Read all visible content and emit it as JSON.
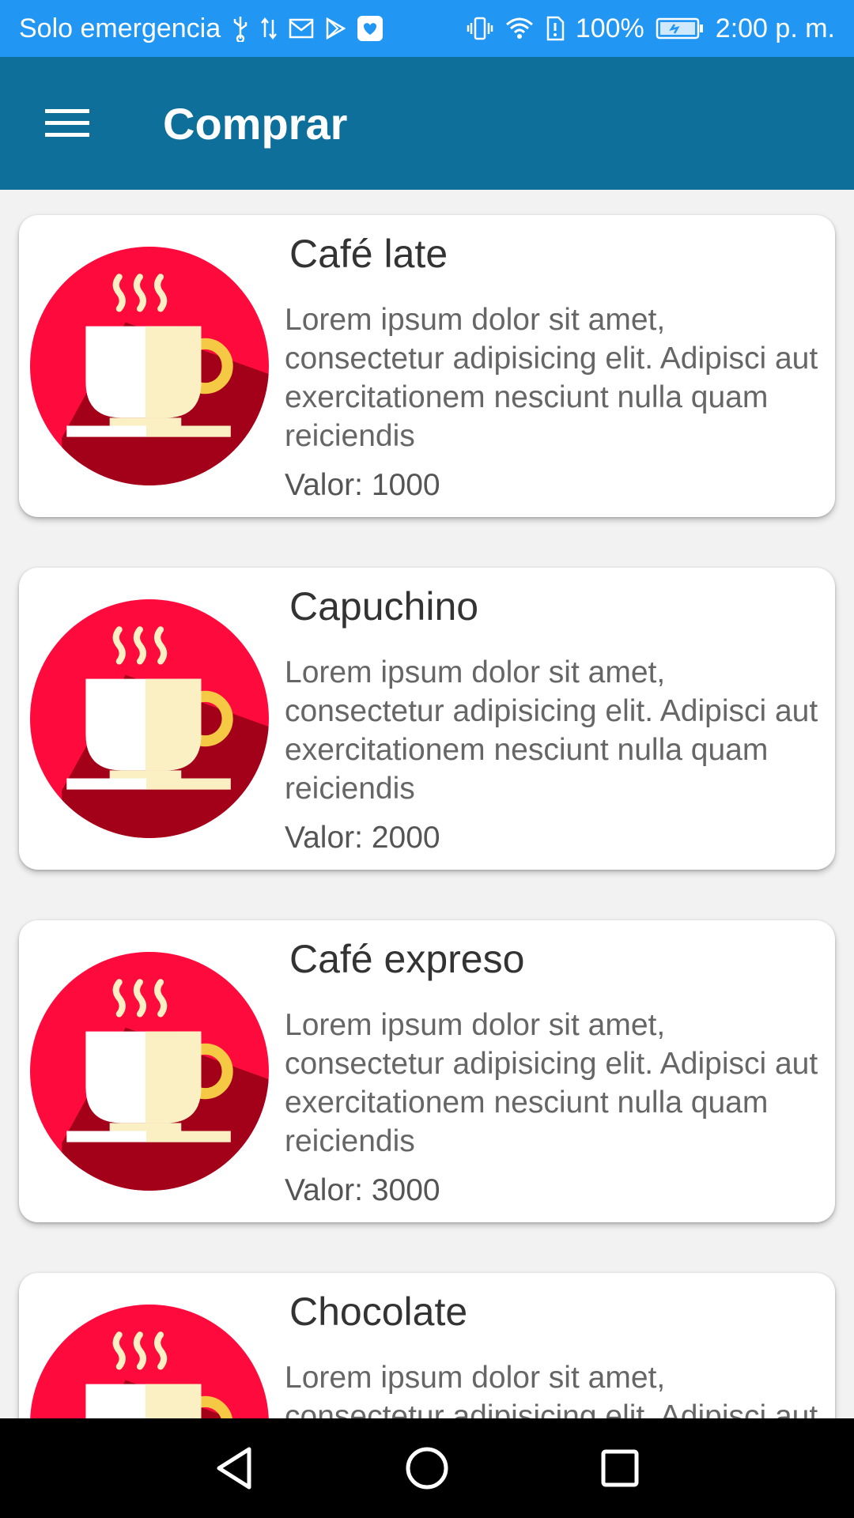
{
  "status_bar": {
    "carrier": "Solo emergencia",
    "battery": "100%",
    "time": "2:00 p. m."
  },
  "app_bar": {
    "title": "Comprar",
    "menu_icon": "hamburger-menu-icon"
  },
  "products": [
    {
      "name": "Café late",
      "description": "Lorem ipsum dolor sit amet, consectetur adipisicing elit. Adipisci aut exercitationem nesciunt nulla quam reiciendis",
      "price": "Valor: 1000",
      "icon": "coffee-cup-icon"
    },
    {
      "name": "Capuchino",
      "description": "Lorem ipsum dolor sit amet, consectetur adipisicing elit. Adipisci aut exercitationem nesciunt nulla quam reiciendis",
      "price": "Valor: 2000",
      "icon": "coffee-cup-icon"
    },
    {
      "name": "Café expreso",
      "description": "Lorem ipsum dolor sit amet, consectetur adipisicing elit. Adipisci aut exercitationem nesciunt nulla quam reiciendis",
      "price": "Valor: 3000",
      "icon": "coffee-cup-icon"
    },
    {
      "name": "Chocolate",
      "description": "Lorem ipsum dolor sit amet, consectetur adipisicing elit. Adipisci aut exercitationem nesciunt nulla quam reiciendis",
      "price": "",
      "icon": "coffee-cup-icon"
    }
  ],
  "nav_bar": {
    "back_icon": "back-triangle-icon",
    "home_icon": "home-circle-icon",
    "recents_icon": "recents-square-icon"
  },
  "colors": {
    "status_bar": "#2196f3",
    "app_bar": "#0d6f9a",
    "icon_circle": "#ff0a3c",
    "icon_shadow": "#a30019",
    "cup_white": "#ffffff",
    "cup_cream": "#fbf0c4",
    "cup_handle": "#f6c944"
  }
}
